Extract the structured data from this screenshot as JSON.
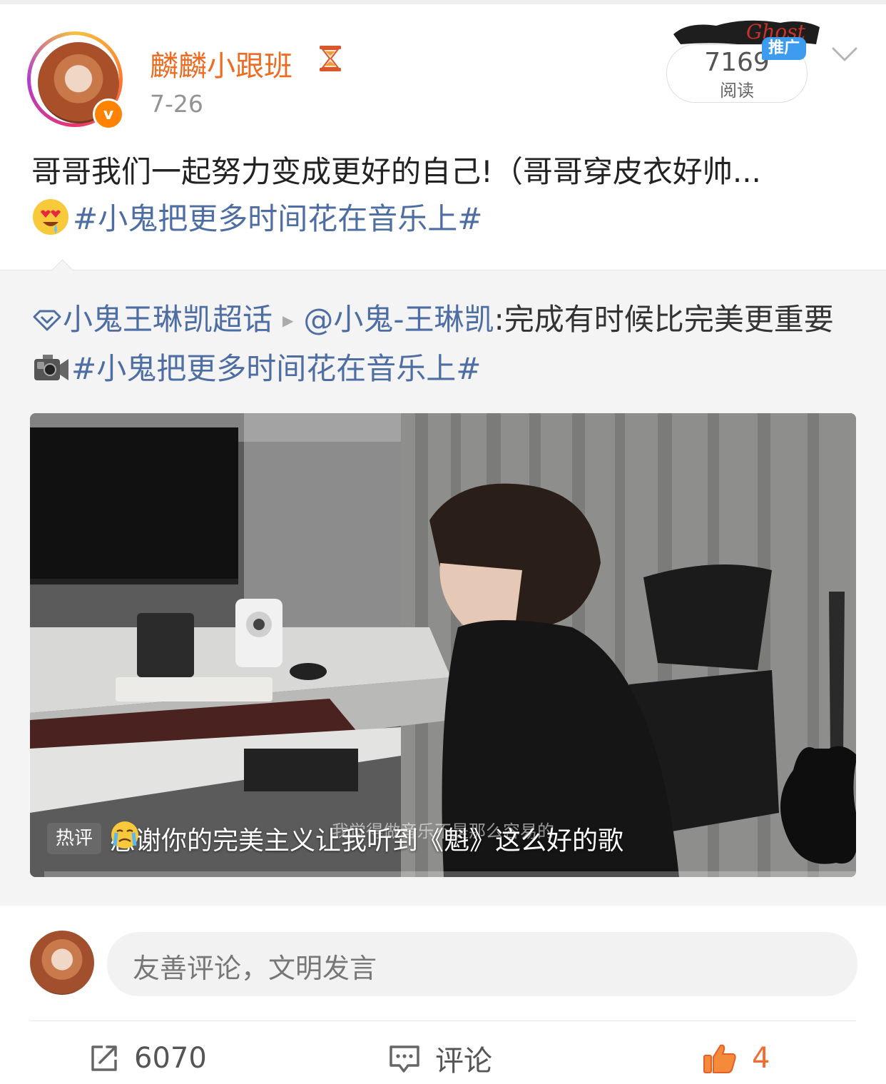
{
  "post": {
    "username": "麟麟小跟班",
    "username_icon": "hourglass-icon",
    "verified_badge": "v",
    "date": "7-26",
    "reads": {
      "count": "7169",
      "label": "阅读"
    },
    "promo_tag": "推广",
    "promo_decoration": "Ghost",
    "text": "哥哥我们一起努力变成更好的自己!（哥哥穿皮衣好帅...",
    "text_emoji": "heart-eyes-drool-emoji",
    "hashtag": "#小鬼把更多时间花在音乐上#"
  },
  "repost": {
    "supertopic": "小鬼王琳凯超话",
    "author": "@小鬼-王琳凯",
    "text": ":完成有时候比完美更重要",
    "text_icon": "video-camera-emoji",
    "hashtag": "#小鬼把更多时间花在音乐上#",
    "video": {
      "subtitle": "我觉得做音乐不是那么容易的",
      "hot_label": "热评",
      "hot_comment": "感谢你的完美主义让我听到《魁》这么好的歌",
      "hot_comment_emoji": "crying-face-emoji"
    }
  },
  "comment_box": {
    "placeholder": "友善评论，文明发言"
  },
  "actions": {
    "share_count": "6070",
    "comment_label": "评论",
    "like_count": "4"
  },
  "colors": {
    "username": "#ee6b22",
    "link": "#4e6ea3",
    "like": "#f36b2d",
    "promo_tag": "#3d9bf0",
    "verified": "#ff8200"
  }
}
